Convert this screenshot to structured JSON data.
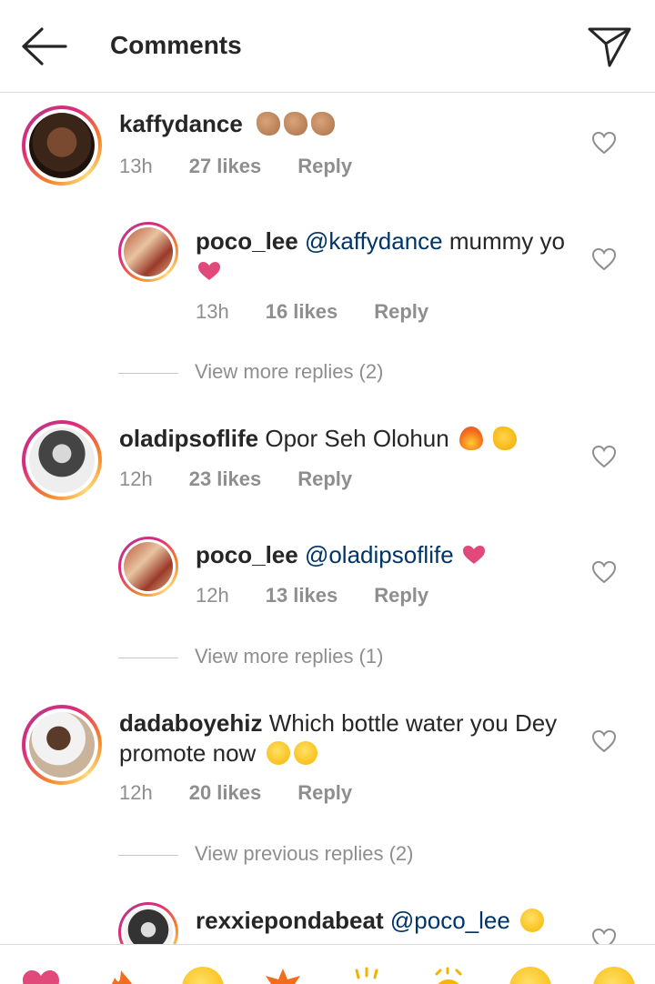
{
  "header": {
    "title": "Comments",
    "back_icon": "arrow-left-icon",
    "send_icon": "paper-plane-icon"
  },
  "comments": [
    {
      "user": "kaffydance",
      "text": "",
      "emojis": [
        "clap",
        "clap",
        "clap"
      ],
      "time": "13h",
      "likes": "27 likes",
      "reply": "Reply"
    },
    {
      "user": "poco_lee",
      "mention": "@kaffydance",
      "text": " mummy yo",
      "time": "13h",
      "likes": "16 likes",
      "reply": "Reply"
    },
    {
      "user": "oladipsoflife",
      "text": " Opor Seh Olohun ",
      "time": "12h",
      "likes": "23 likes",
      "reply": "Reply"
    },
    {
      "user": "poco_lee",
      "mention": "@oladipsoflife",
      "text": "",
      "time": "12h",
      "likes": "13 likes",
      "reply": "Reply"
    },
    {
      "user": "dadaboyehiz",
      "text": " Which bottle water you Dey promote now ",
      "time": "12h",
      "likes": "20 likes",
      "reply": "Reply"
    },
    {
      "user": "rexxiepondabeat",
      "mention": "@poco_lee",
      "text": ""
    }
  ],
  "more_replies": [
    "View more replies (2)",
    "View more replies (1)",
    "View previous replies (2)"
  ],
  "reactions": [
    "heart-icon",
    "fire-icon",
    "heart-eyes-icon",
    "boom-icon",
    "sparkle-icon",
    "clap-icon",
    "smile-icon",
    "grin-icon"
  ],
  "colors": {
    "mention": "#003569",
    "meta": "#8e8e8e",
    "text": "#262626",
    "heart": "#e0497a"
  }
}
